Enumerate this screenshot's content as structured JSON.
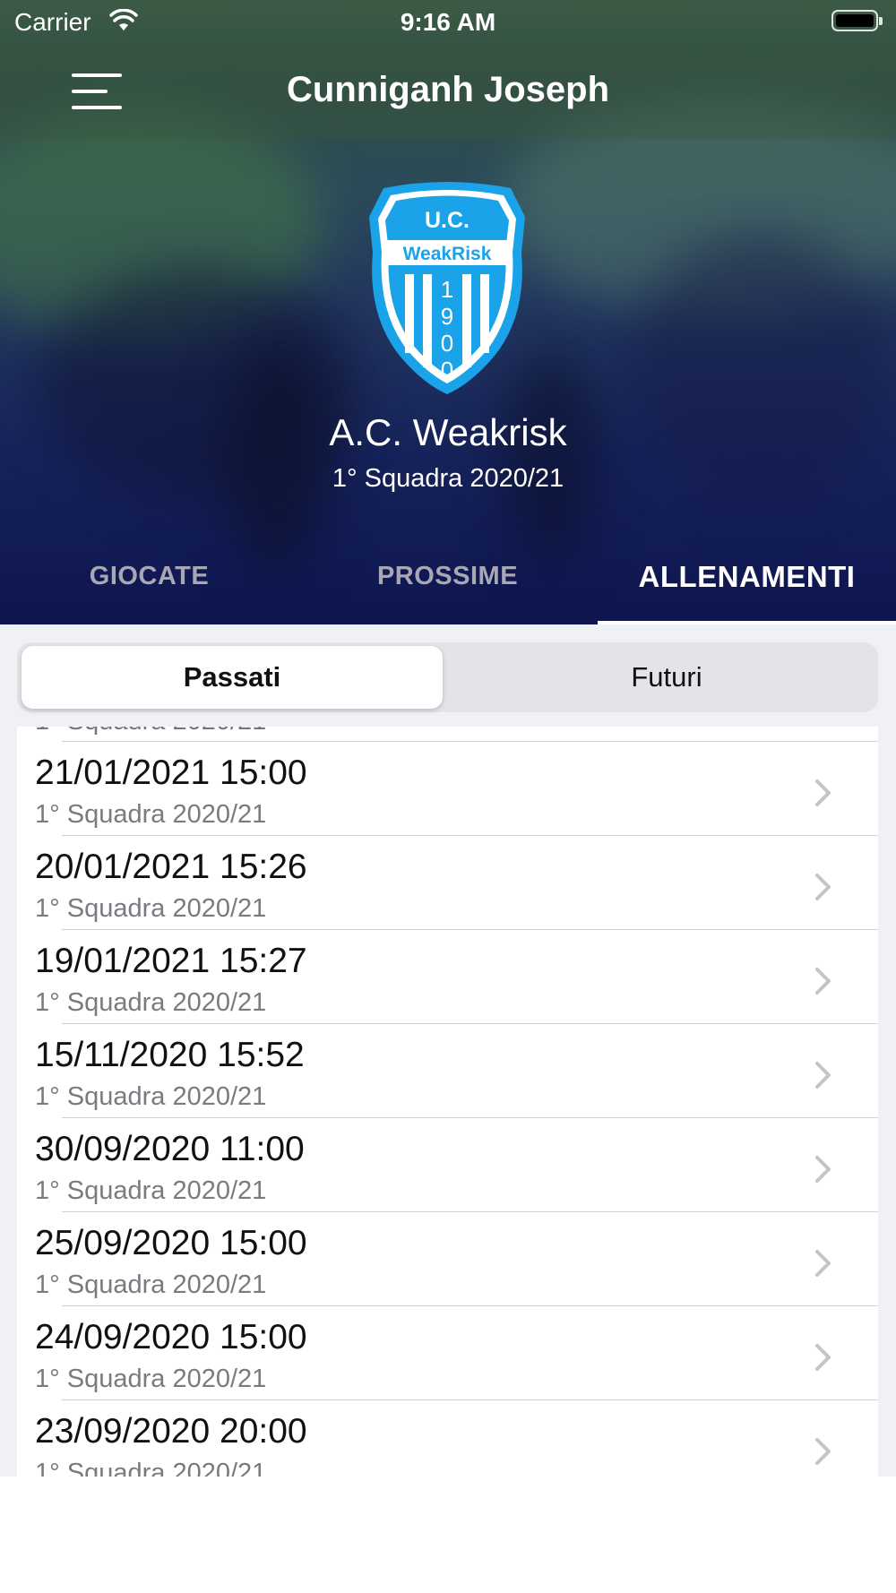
{
  "status_bar": {
    "carrier": "Carrier",
    "time": "9:16 AM"
  },
  "nav": {
    "title": "Cunniganh Joseph",
    "menu_icon": "hamburger-menu-icon"
  },
  "team": {
    "crest_icon": "club-crest-icon",
    "crest_top": "U.C.",
    "crest_band": "WeakRisk",
    "crest_year": [
      "1",
      "9",
      "0",
      "0"
    ],
    "name": "A.C. Weakrisk",
    "subtitle": "1° Squadra 2020/21"
  },
  "tabs": [
    {
      "label": "GIOCATE",
      "active": false
    },
    {
      "label": "PROSSIME",
      "active": false
    },
    {
      "label": "ALLENAMENTI",
      "active": true
    }
  ],
  "segmented": {
    "past": "Passati",
    "future": "Futuri",
    "selected": "Passati"
  },
  "trainings": [
    {
      "datetime": "21/01/2021 15:00",
      "team": "1° Squadra 2020/21"
    },
    {
      "datetime": "20/01/2021 15:26",
      "team": "1° Squadra 2020/21"
    },
    {
      "datetime": "19/01/2021 15:27",
      "team": "1° Squadra 2020/21"
    },
    {
      "datetime": "15/11/2020 15:52",
      "team": "1° Squadra 2020/21"
    },
    {
      "datetime": "30/09/2020 11:00",
      "team": "1° Squadra 2020/21"
    },
    {
      "datetime": "25/09/2020 15:00",
      "team": "1° Squadra 2020/21"
    },
    {
      "datetime": "24/09/2020 15:00",
      "team": "1° Squadra 2020/21"
    },
    {
      "datetime": "23/09/2020 20:00",
      "team": "1° Squadra 2020/21"
    }
  ],
  "colors": {
    "crest_blue": "#1aa3e8",
    "active_tab": "#ffffff",
    "inactive_tab": "#a8a8b4",
    "list_background": "#eff1f4"
  }
}
